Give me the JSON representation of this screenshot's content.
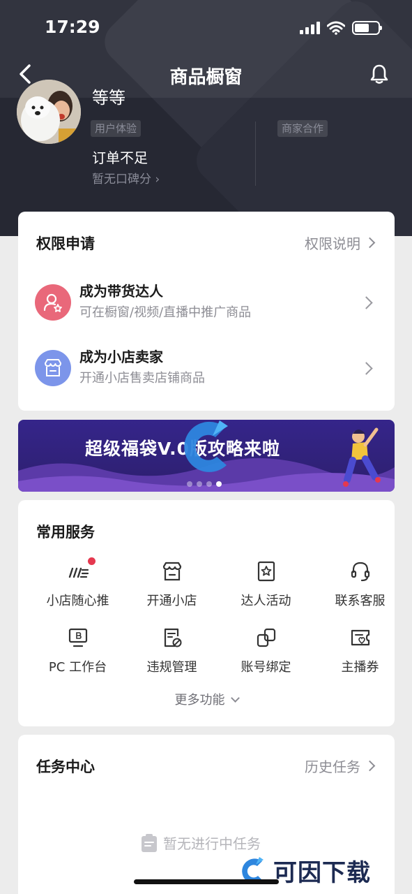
{
  "status_bar": {
    "time": "17:29"
  },
  "header": {
    "title": "商品橱窗"
  },
  "profile": {
    "name": "等等",
    "tag_user_experience": "用户体验",
    "tag_merchant_coop": "商家合作",
    "order_status": "订单不足",
    "rating_text": "暂无口碑分 ›"
  },
  "permissions": {
    "title": "权限申请",
    "link": "权限说明",
    "items": [
      {
        "title": "成为带货达人",
        "subtitle": "可在橱窗/视频/直播中推广商品",
        "icon": "user-star-icon",
        "color": "#e9687a"
      },
      {
        "title": "成为小店卖家",
        "subtitle": "开通小店售卖店铺商品",
        "icon": "shop-icon",
        "color": "#7c95ea"
      }
    ]
  },
  "banner": {
    "text": "超级福袋V.0版攻略来啦",
    "dots": 4,
    "active_dot": 3
  },
  "services": {
    "title": "常用服务",
    "items": [
      {
        "label": "小店随心推",
        "icon": "promote-icon"
      },
      {
        "label": "开通小店",
        "icon": "shop-icon"
      },
      {
        "label": "达人活动",
        "icon": "star-badge-icon"
      },
      {
        "label": "联系客服",
        "icon": "headset-icon"
      },
      {
        "label": "PC 工作台",
        "icon": "pc-icon"
      },
      {
        "label": "违规管理",
        "icon": "violation-icon"
      },
      {
        "label": "账号绑定",
        "icon": "link-icon"
      },
      {
        "label": "主播券",
        "icon": "coupon-icon"
      }
    ],
    "more": "更多功能"
  },
  "tasks": {
    "title": "任务中心",
    "link": "历史任务",
    "empty": "暂无进行中任务"
  },
  "watermark": {
    "text": "可因下载"
  },
  "colors": {
    "accent_red": "#e5384f",
    "header_bg": "#262833"
  }
}
